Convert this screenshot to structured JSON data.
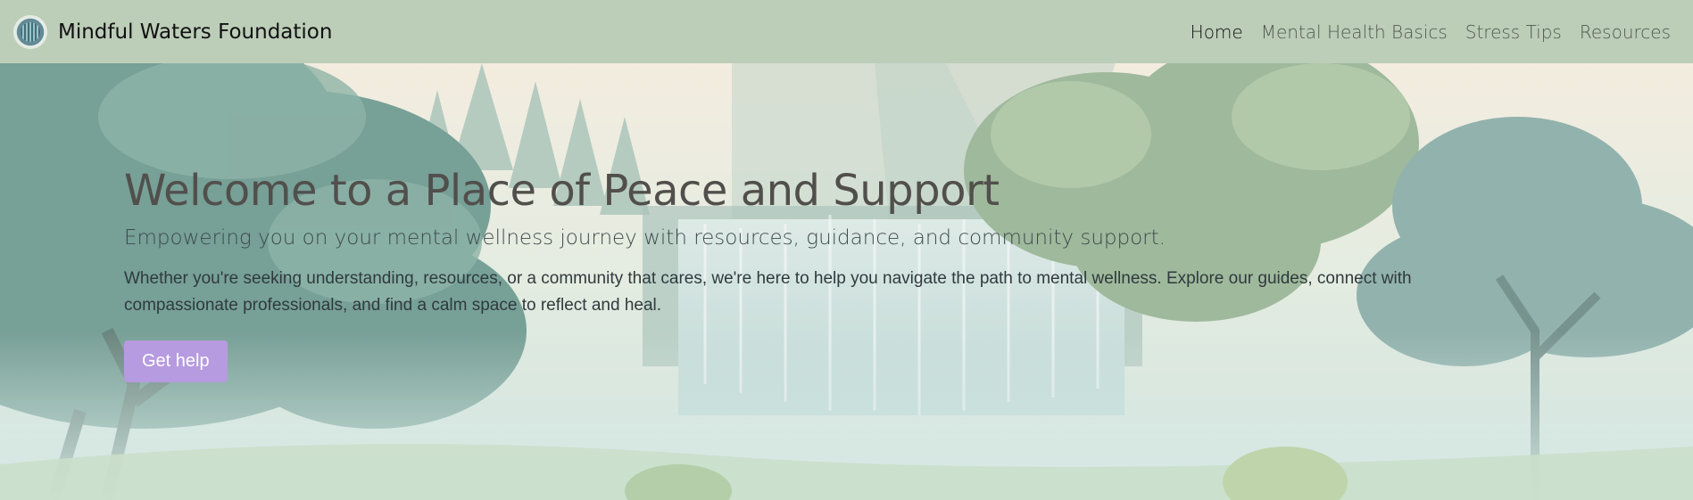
{
  "brand": {
    "name": "Mindful Waters Foundation",
    "logo_icon": "waterfall-logo-icon"
  },
  "nav": {
    "items": [
      {
        "label": "Home",
        "active": true
      },
      {
        "label": "Mental Health Basics",
        "active": false
      },
      {
        "label": "Stress Tips",
        "active": false
      },
      {
        "label": "Resources",
        "active": false
      }
    ]
  },
  "hero": {
    "title": "Welcome to a Place of Peace and Support",
    "subtitle": "Empowering you on your mental wellness journey with resources, guidance, and community support.",
    "body": "Whether you're seeking understanding, resources, or a community that cares, we're here to help you navigate the path to mental wellness. Explore our guides, connect with compassionate professionals, and find a calm space to reflect and heal.",
    "cta_label": "Get help",
    "background_image": "waterfall-forest-illustration"
  },
  "colors": {
    "navbar": "#bccdb8",
    "cta": "#b69be0",
    "title": "#514f4c"
  }
}
